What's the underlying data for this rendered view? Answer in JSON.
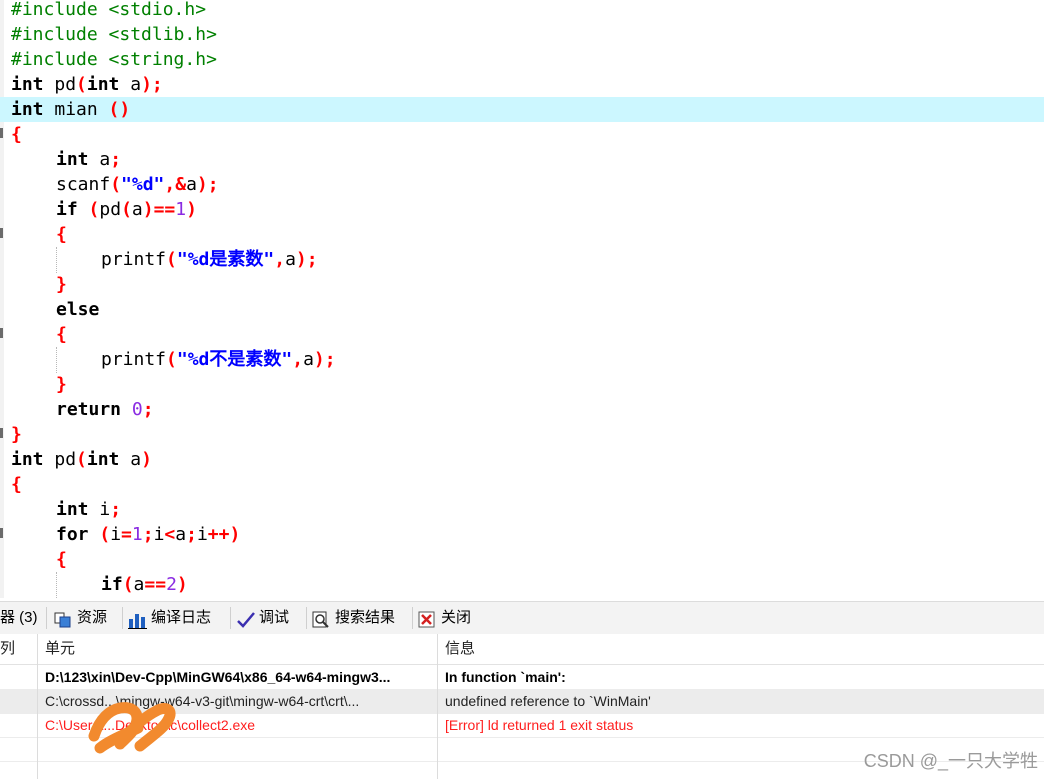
{
  "editor": {
    "lines": [
      {
        "tokens": [
          {
            "t": "#include <stdio.h>",
            "c": "pp"
          }
        ],
        "indent": 0
      },
      {
        "tokens": [
          {
            "t": "#include <stdlib.h>",
            "c": "pp"
          }
        ],
        "indent": 0
      },
      {
        "tokens": [
          {
            "t": "#include <string.h>",
            "c": "pp"
          }
        ],
        "indent": 0
      },
      {
        "tokens": [
          {
            "t": "int",
            "c": "kw"
          },
          {
            "t": " pd",
            "c": "plain"
          },
          {
            "t": "(",
            "c": "sym"
          },
          {
            "t": "int",
            "c": "kw"
          },
          {
            "t": " a",
            "c": "plain"
          },
          {
            "t": ");",
            "c": "sym"
          }
        ],
        "indent": 0
      },
      {
        "tokens": [
          {
            "t": "int",
            "c": "kw"
          },
          {
            "t": " mian ",
            "c": "plain"
          },
          {
            "t": "()",
            "c": "sym"
          }
        ],
        "indent": 0,
        "current": true
      },
      {
        "tokens": [
          {
            "t": "{",
            "c": "sym"
          }
        ],
        "indent": 0
      },
      {
        "tokens": [
          {
            "t": "int",
            "c": "kw"
          },
          {
            "t": " a",
            "c": "plain"
          },
          {
            "t": ";",
            "c": "sym"
          }
        ],
        "indent": 1
      },
      {
        "tokens": [
          {
            "t": "scanf",
            "c": "plain"
          },
          {
            "t": "(",
            "c": "sym"
          },
          {
            "t": "\"%d\"",
            "c": "str"
          },
          {
            "t": ",&",
            "c": "sym"
          },
          {
            "t": "a",
            "c": "plain"
          },
          {
            "t": ");",
            "c": "sym"
          }
        ],
        "indent": 1
      },
      {
        "tokens": [
          {
            "t": "if",
            "c": "kw"
          },
          {
            "t": " ",
            "c": "plain"
          },
          {
            "t": "(",
            "c": "sym"
          },
          {
            "t": "pd",
            "c": "plain"
          },
          {
            "t": "(",
            "c": "sym"
          },
          {
            "t": "a",
            "c": "plain"
          },
          {
            "t": ")==",
            "c": "sym"
          },
          {
            "t": "1",
            "c": "num"
          },
          {
            "t": ")",
            "c": "sym"
          }
        ],
        "indent": 1
      },
      {
        "tokens": [
          {
            "t": "{",
            "c": "sym"
          }
        ],
        "indent": 1
      },
      {
        "tokens": [
          {
            "t": "printf",
            "c": "plain"
          },
          {
            "t": "(",
            "c": "sym"
          },
          {
            "t": "\"%d是素数\"",
            "c": "str"
          },
          {
            "t": ",",
            "c": "sym"
          },
          {
            "t": "a",
            "c": "plain"
          },
          {
            "t": ");",
            "c": "sym"
          }
        ],
        "indent": 2
      },
      {
        "tokens": [
          {
            "t": "}",
            "c": "sym"
          }
        ],
        "indent": 1
      },
      {
        "tokens": [
          {
            "t": "else",
            "c": "kw"
          }
        ],
        "indent": 1
      },
      {
        "tokens": [
          {
            "t": "{",
            "c": "sym"
          }
        ],
        "indent": 1
      },
      {
        "tokens": [
          {
            "t": "printf",
            "c": "plain"
          },
          {
            "t": "(",
            "c": "sym"
          },
          {
            "t": "\"%d不是素数\"",
            "c": "str"
          },
          {
            "t": ",",
            "c": "sym"
          },
          {
            "t": "a",
            "c": "plain"
          },
          {
            "t": ");",
            "c": "sym"
          }
        ],
        "indent": 2
      },
      {
        "tokens": [
          {
            "t": "}",
            "c": "sym"
          }
        ],
        "indent": 1
      },
      {
        "tokens": [
          {
            "t": "return",
            "c": "kw"
          },
          {
            "t": " ",
            "c": "plain"
          },
          {
            "t": "0",
            "c": "num"
          },
          {
            "t": ";",
            "c": "sym"
          }
        ],
        "indent": 1
      },
      {
        "tokens": [
          {
            "t": "}",
            "c": "sym"
          }
        ],
        "indent": 0
      },
      {
        "tokens": [
          {
            "t": "int",
            "c": "kw"
          },
          {
            "t": " pd",
            "c": "plain"
          },
          {
            "t": "(",
            "c": "sym"
          },
          {
            "t": "int",
            "c": "kw"
          },
          {
            "t": " a",
            "c": "plain"
          },
          {
            "t": ")",
            "c": "sym"
          }
        ],
        "indent": 0
      },
      {
        "tokens": [
          {
            "t": "{",
            "c": "sym"
          }
        ],
        "indent": 0
      },
      {
        "tokens": [
          {
            "t": "int",
            "c": "kw"
          },
          {
            "t": " i",
            "c": "plain"
          },
          {
            "t": ";",
            "c": "sym"
          }
        ],
        "indent": 1
      },
      {
        "tokens": [
          {
            "t": "for",
            "c": "kw"
          },
          {
            "t": " ",
            "c": "plain"
          },
          {
            "t": "(",
            "c": "sym"
          },
          {
            "t": "i",
            "c": "plain"
          },
          {
            "t": "=",
            "c": "sym"
          },
          {
            "t": "1",
            "c": "num"
          },
          {
            "t": ";",
            "c": "sym"
          },
          {
            "t": "i",
            "c": "plain"
          },
          {
            "t": "<",
            "c": "sym"
          },
          {
            "t": "a",
            "c": "plain"
          },
          {
            "t": ";",
            "c": "sym"
          },
          {
            "t": "i",
            "c": "plain"
          },
          {
            "t": "++)",
            "c": "sym"
          }
        ],
        "indent": 1
      },
      {
        "tokens": [
          {
            "t": "{",
            "c": "sym"
          }
        ],
        "indent": 1
      },
      {
        "tokens": [
          {
            "t": "if",
            "c": "kw"
          },
          {
            "t": "(",
            "c": "sym"
          },
          {
            "t": "a",
            "c": "plain"
          },
          {
            "t": "==",
            "c": "sym"
          },
          {
            "t": "2",
            "c": "num"
          },
          {
            "t": ")",
            "c": "sym"
          }
        ],
        "indent": 2
      }
    ]
  },
  "panel": {
    "tabs": [
      {
        "label": "器 (3)",
        "icon": "compiler-icon"
      },
      {
        "label": "资源",
        "icon": "resources-icon"
      },
      {
        "label": "编译日志",
        "icon": "compile-log-icon"
      },
      {
        "label": "调试",
        "icon": "debug-icon"
      },
      {
        "label": "搜索结果",
        "icon": "search-results-icon"
      },
      {
        "label": "关闭",
        "icon": "close-icon"
      }
    ],
    "columns": {
      "col": "列",
      "unit": "单元",
      "info": "信息"
    },
    "rows": [
      {
        "unit": "D:\\123\\xin\\Dev-Cpp\\MinGW64\\x86_64-w64-mingw3...",
        "info": "In function `main':",
        "style": "bold"
      },
      {
        "unit": "C:\\crossd...\\mingw-w64-v3-git\\mingw-w64-crt\\crt\\...",
        "info": "undefined reference to `WinMain'",
        "style": "normal",
        "selected": true
      },
      {
        "unit": "C:\\Users\\...Desktop\\c\\collect2.exe",
        "info": "[Error] ld returned 1 exit status",
        "style": "err"
      }
    ]
  },
  "watermark": "CSDN @_一只大学牲",
  "colors": {
    "current_line": "#ccf7ff",
    "error_text": "#ff1e1e",
    "scribble": "#f28a2e"
  }
}
